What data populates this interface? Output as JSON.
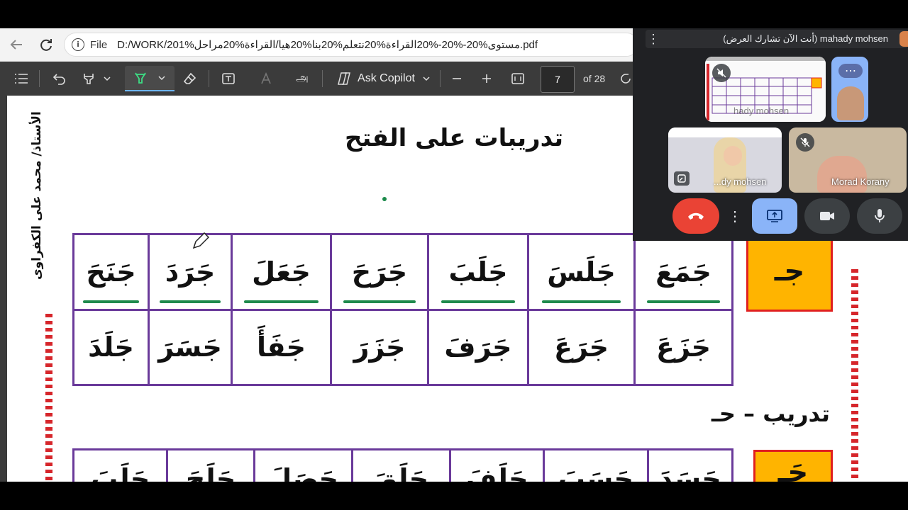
{
  "browser": {
    "url_scheme": "File",
    "url": "D:/WORK/201%مستوى%20-%20-%20القراءة%20نتعلم%20بنا%20هيا/القراءة%20مراحل.pdf"
  },
  "pdf_toolbar": {
    "copilot_label": "Ask Copilot",
    "page_current": "7",
    "page_total": "of 28",
    "read_aloud_glyph": "அ"
  },
  "document": {
    "author": "الأستاذ/ محمد على الكفراوى",
    "title": "تدريبات على الفتح",
    "section1_letter": "جـ",
    "row1": [
      "جَمَعَ",
      "جَلَسَ",
      "جَلَبَ",
      "جَرَحَ",
      "جَعَلَ",
      "جَرَدَ",
      "جَنَحَ"
    ],
    "row2": [
      "جَزَعَ",
      "جَرَعَ",
      "جَرَفَ",
      "جَزَرَ",
      "جَفَأَ",
      "جَسَرَ",
      "جَلَدَ"
    ],
    "section2_title": "تدريب – حـ",
    "section2_letter": "حَـ",
    "row3": [
      "حَسَدَ",
      "حَسَبَ",
      "حَلَفَ",
      "حَلَقَ",
      "حَصَلَ",
      "حَلَجَ",
      "حَلَبَ"
    ]
  },
  "meet": {
    "status": "mahady mohsen (أنت الآن تشارك العرض)",
    "tiles": [
      {
        "name": "hady mohsen"
      },
      {
        "name": "...dy mohsen"
      },
      {
        "name": "Morad Korany"
      }
    ]
  },
  "colors": {
    "toolbar_bg": "#3b3b3b",
    "grid_border": "#6a3a9a",
    "letter_box": "#ffb400",
    "letter_box_border": "#e02020",
    "underline": "#1e8a4c",
    "end_call": "#ea4335",
    "share_active": "#8ab4f8"
  }
}
